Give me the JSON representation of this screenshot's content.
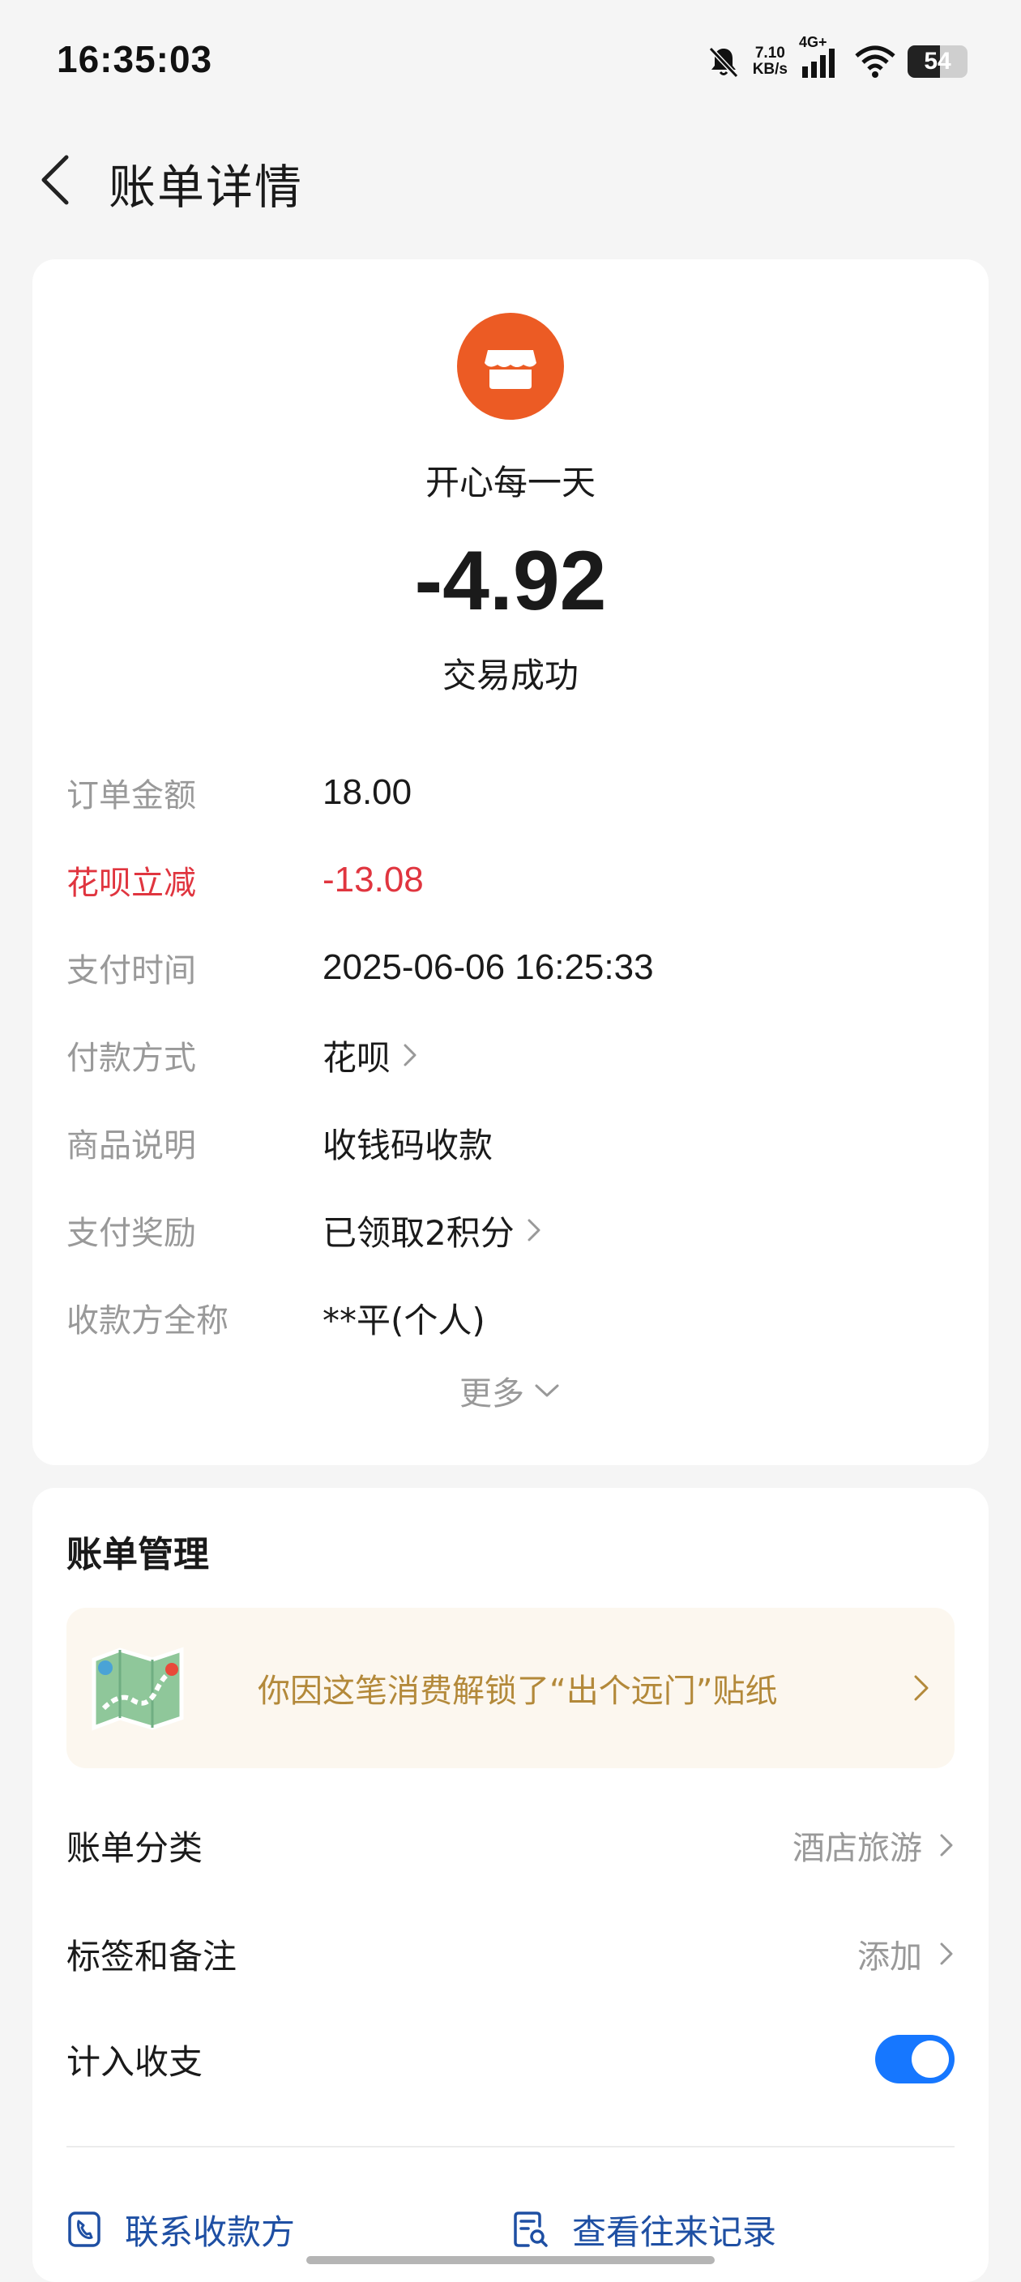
{
  "status_bar": {
    "time": "16:35:03",
    "net_speed_value": "7.10",
    "net_speed_unit": "KB/s",
    "network_type": "4G+",
    "battery": "54",
    "battery_level": 0.54
  },
  "header": {
    "title": "账单详情",
    "back_icon": "chevron-left-icon"
  },
  "summary": {
    "merchant_icon": "shop-icon",
    "merchant_icon_color": "#ec5b24",
    "merchant_name": "开心每一天",
    "amount": "-4.92",
    "status": "交易成功"
  },
  "details": [
    {
      "label": "订单金额",
      "value": "18.00"
    },
    {
      "label": "花呗立减",
      "value": "-13.08",
      "highlight_color": "#e0353f"
    },
    {
      "label": "支付时间",
      "value": "2025-06-06 16:25:33"
    },
    {
      "label": "付款方式",
      "value": "花呗"
    },
    {
      "label": "商品说明",
      "value": "收钱码收款"
    },
    {
      "label": "支付奖励",
      "value": "已领取2积分"
    },
    {
      "label": "收款方全称",
      "value": "**平(个人)"
    }
  ],
  "more_label": "更多",
  "management": {
    "title": "账单管理",
    "sticker_text": "你因这笔消费解锁了“出个远门”贴纸",
    "sticker_icon": "map-sticker-icon",
    "rows": [
      {
        "label": "账单分类",
        "value": "酒店旅游"
      },
      {
        "label": "标签和备注",
        "value": "添加"
      },
      {
        "label": "计入收支",
        "toggle_on": true
      }
    ],
    "actions": [
      {
        "label": "联系收款方",
        "icon": "phone-icon"
      },
      {
        "label": "查看往来记录",
        "icon": "record-search-icon"
      }
    ]
  },
  "colors": {
    "accent_blue": "#1677ff",
    "link_blue": "#1e4fa3",
    "discount_red": "#e0353f",
    "sticker_gold": "#b3893a"
  }
}
